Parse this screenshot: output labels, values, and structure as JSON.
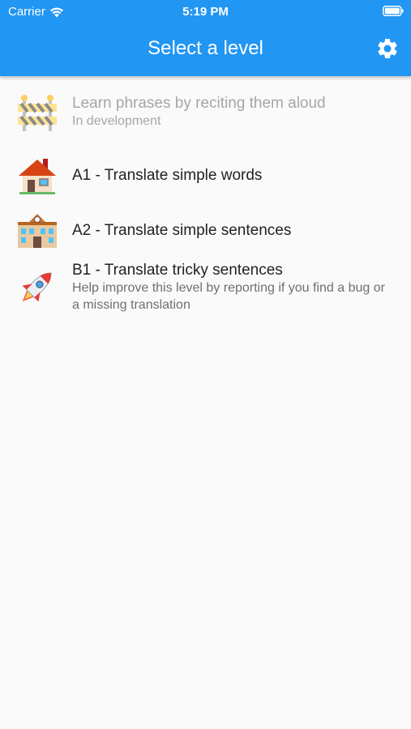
{
  "status_bar": {
    "carrier": "Carrier",
    "time": "5:19 PM"
  },
  "appbar": {
    "title": "Select a level",
    "color": "#2196f3"
  },
  "levels": [
    {
      "icon": "construction-barrier-icon",
      "title": "Learn phrases by reciting them aloud",
      "subtitle": "In development",
      "enabled": false
    },
    {
      "icon": "house-icon",
      "title": "A1 - Translate simple words",
      "enabled": true
    },
    {
      "icon": "school-building-icon",
      "title": "A2 - Translate simple sentences",
      "enabled": true
    },
    {
      "icon": "rocket-icon",
      "title": "B1 - Translate tricky sentences",
      "subtitle": "Help improve this level by reporting if you find a bug or a missing translation",
      "enabled": true
    }
  ]
}
